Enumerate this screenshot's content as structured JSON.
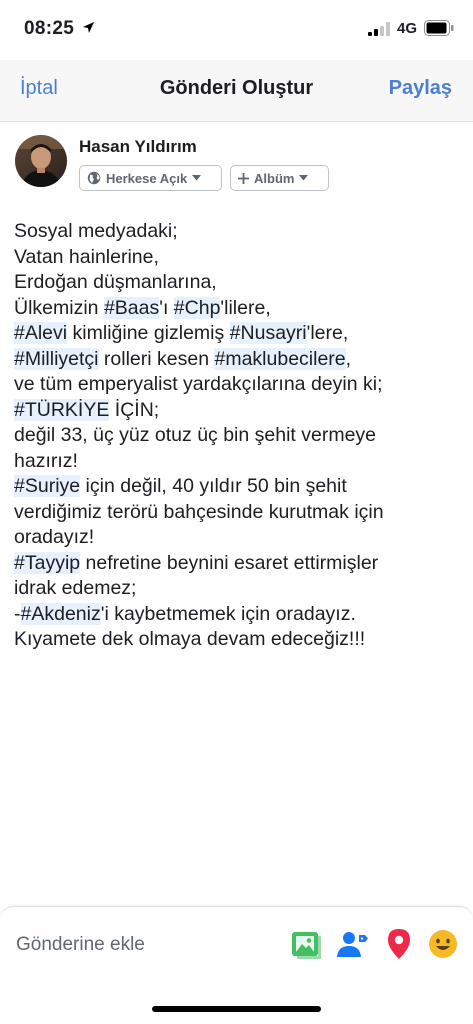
{
  "status_bar": {
    "time": "08:25",
    "network": "4G"
  },
  "nav": {
    "cancel_label": "İptal",
    "title": "Gönderi Oluştur",
    "share_label": "Paylaş"
  },
  "author": {
    "name": "Hasan Yıldırım",
    "privacy_label": "Herkese Açık",
    "album_label": "Albüm"
  },
  "post": {
    "lines": [
      [
        {
          "t": "Sosyal medyadaki;"
        }
      ],
      [
        {
          "t": "Vatan hainlerine,"
        }
      ],
      [
        {
          "t": "Erdoğan düşmanlarına,"
        }
      ],
      [
        {
          "t": "Ülkemizin "
        },
        {
          "t": "#Baas",
          "tag": true
        },
        {
          "t": "'ı "
        },
        {
          "t": "#Chp",
          "tag": true
        },
        {
          "t": "'lilere,"
        }
      ],
      [
        {
          "t": "#Alevi",
          "tag": true
        },
        {
          "t": " kimliğine gizlemiş "
        },
        {
          "t": "#Nusayri",
          "tag": true
        },
        {
          "t": "'lere,"
        }
      ],
      [
        {
          "t": "#Milliyetçi",
          "tag": true
        },
        {
          "t": " rolleri kesen "
        },
        {
          "t": "#maklubecilere",
          "tag": true
        },
        {
          "t": ","
        }
      ],
      [
        {
          "t": "ve tüm emperyalist yardakçılarına deyin ki;"
        }
      ],
      [
        {
          "t": "#TÜRKİYE",
          "tag": true
        },
        {
          "t": " İÇİN;"
        }
      ],
      [
        {
          "t": "değil 33, üç yüz otuz üç bin şehit vermeye"
        }
      ],
      [
        {
          "t": "hazırız!"
        }
      ],
      [
        {
          "t": "#Suriye",
          "tag": true
        },
        {
          "t": " için değil, 40 yıldır 50 bin şehit"
        }
      ],
      [
        {
          "t": "verdiğimiz terörü bahçesinde kurutmak için"
        }
      ],
      [
        {
          "t": "oradayız!"
        }
      ],
      [
        {
          "t": "#Tayyip",
          "tag": true
        },
        {
          "t": " nefretine beynini esaret ettirmişler"
        }
      ],
      [
        {
          "t": "idrak edemez;"
        }
      ],
      [
        {
          "t": "-"
        },
        {
          "t": "#Akdeniz",
          "tag": true
        },
        {
          "t": "'i kaybetmemek için oradayız."
        }
      ],
      [
        {
          "t": "Kıyamete dek olmaya devam edeceğiz!!!"
        }
      ]
    ]
  },
  "composer": {
    "add_label": "Gönderine ekle",
    "tools": [
      "photo-icon",
      "tag-people-icon",
      "location-pin-icon",
      "feeling-smiley-icon"
    ]
  },
  "colors": {
    "accent": "#4a7fd4",
    "hashtag_highlight": "#e7f0fd",
    "photo_green": "#45bd62",
    "tag_blue": "#1877f2",
    "location_red": "#f02849",
    "feeling_yellow": "#f7b928"
  }
}
